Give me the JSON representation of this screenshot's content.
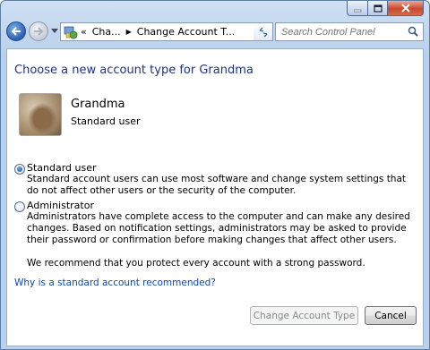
{
  "address_bar": {
    "breadcrumbs": [
      "«",
      "Cha...",
      "Change Account T..."
    ]
  },
  "search": {
    "placeholder": "Search Control Panel"
  },
  "page": {
    "title": "Choose a new account type for Grandma",
    "user": {
      "name": "Grandma",
      "type": "Standard user"
    },
    "options": [
      {
        "label": "Standard user",
        "selected": true,
        "description": "Standard account users can use most software and change system settings that do not affect other users or the security of the computer."
      },
      {
        "label": "Administrator",
        "selected": false,
        "description": "Administrators have complete access to the computer and can make any desired changes. Based on notification settings, administrators may be asked to provide their password or confirmation before making changes that affect other users."
      }
    ],
    "recommendation": "We recommend that you protect every account with a strong password.",
    "help_link": "Why is a standard account recommended?"
  },
  "buttons": {
    "change": "Change Account Type",
    "cancel": "Cancel"
  },
  "colors": {
    "title": "#1e3287",
    "link": "#0a46b5",
    "frame": "#b9d1ec"
  }
}
